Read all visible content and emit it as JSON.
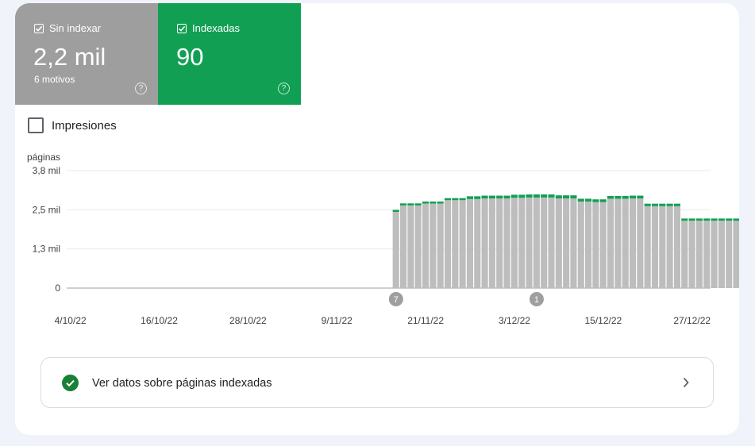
{
  "tiles": {
    "not_indexed": {
      "label": "Sin indexar",
      "value": "2,2 mil",
      "sub": "6 motivos",
      "color": "#9e9e9e"
    },
    "indexed": {
      "label": "Indexadas",
      "value": "90",
      "color": "#11a053"
    }
  },
  "impressions": {
    "label": "Impresiones",
    "checked": false
  },
  "chart_data": {
    "type": "bar",
    "stacked": true,
    "ylabel": "páginas",
    "yticks": [
      "3,8 mil",
      "2,5 mil",
      "1,3 mil",
      "0"
    ],
    "ylim": [
      0,
      3800
    ],
    "xticks": [
      "4/10/22",
      "16/10/22",
      "28/10/22",
      "9/11/22",
      "21/11/22",
      "3/12/22",
      "15/12/22",
      "27/12/22"
    ],
    "date_range": [
      "2022-10-04",
      "2022-12-29"
    ],
    "first_bar_index": 44,
    "series": [
      {
        "name": "Sin indexar",
        "color": "#bdbdbd",
        "values": [
          2490,
          2690,
          2690,
          2690,
          2750,
          2750,
          2750,
          2860,
          2860,
          2860,
          2880,
          2880,
          2900,
          2900,
          2900,
          2900,
          2920,
          2920,
          2930,
          2930,
          2930,
          2930,
          2900,
          2900,
          2900,
          2800,
          2800,
          2780,
          2780,
          2890,
          2890,
          2890,
          2900,
          2900,
          2650,
          2650,
          2650,
          2650,
          2650,
          2180,
          2180,
          2180,
          2180,
          2180,
          2180,
          2180,
          2180
        ]
      },
      {
        "name": "Indexadas",
        "color": "#11a053",
        "values": [
          40,
          50,
          50,
          50,
          50,
          50,
          50,
          50,
          50,
          50,
          90,
          90,
          90,
          90,
          90,
          90,
          100,
          100,
          100,
          100,
          100,
          100,
          100,
          100,
          100,
          90,
          90,
          90,
          90,
          90,
          90,
          90,
          90,
          90,
          80,
          80,
          80,
          80,
          80,
          70,
          70,
          70,
          70,
          70,
          70,
          70,
          70
        ]
      }
    ],
    "annotations": [
      {
        "label": "7",
        "date": "2022-11-17"
      },
      {
        "label": "1",
        "date": "2022-12-06"
      }
    ]
  },
  "link": {
    "label": "Ver datos sobre páginas indexadas",
    "icon": "check-circle-icon",
    "chevron": "chevron-right-icon"
  }
}
